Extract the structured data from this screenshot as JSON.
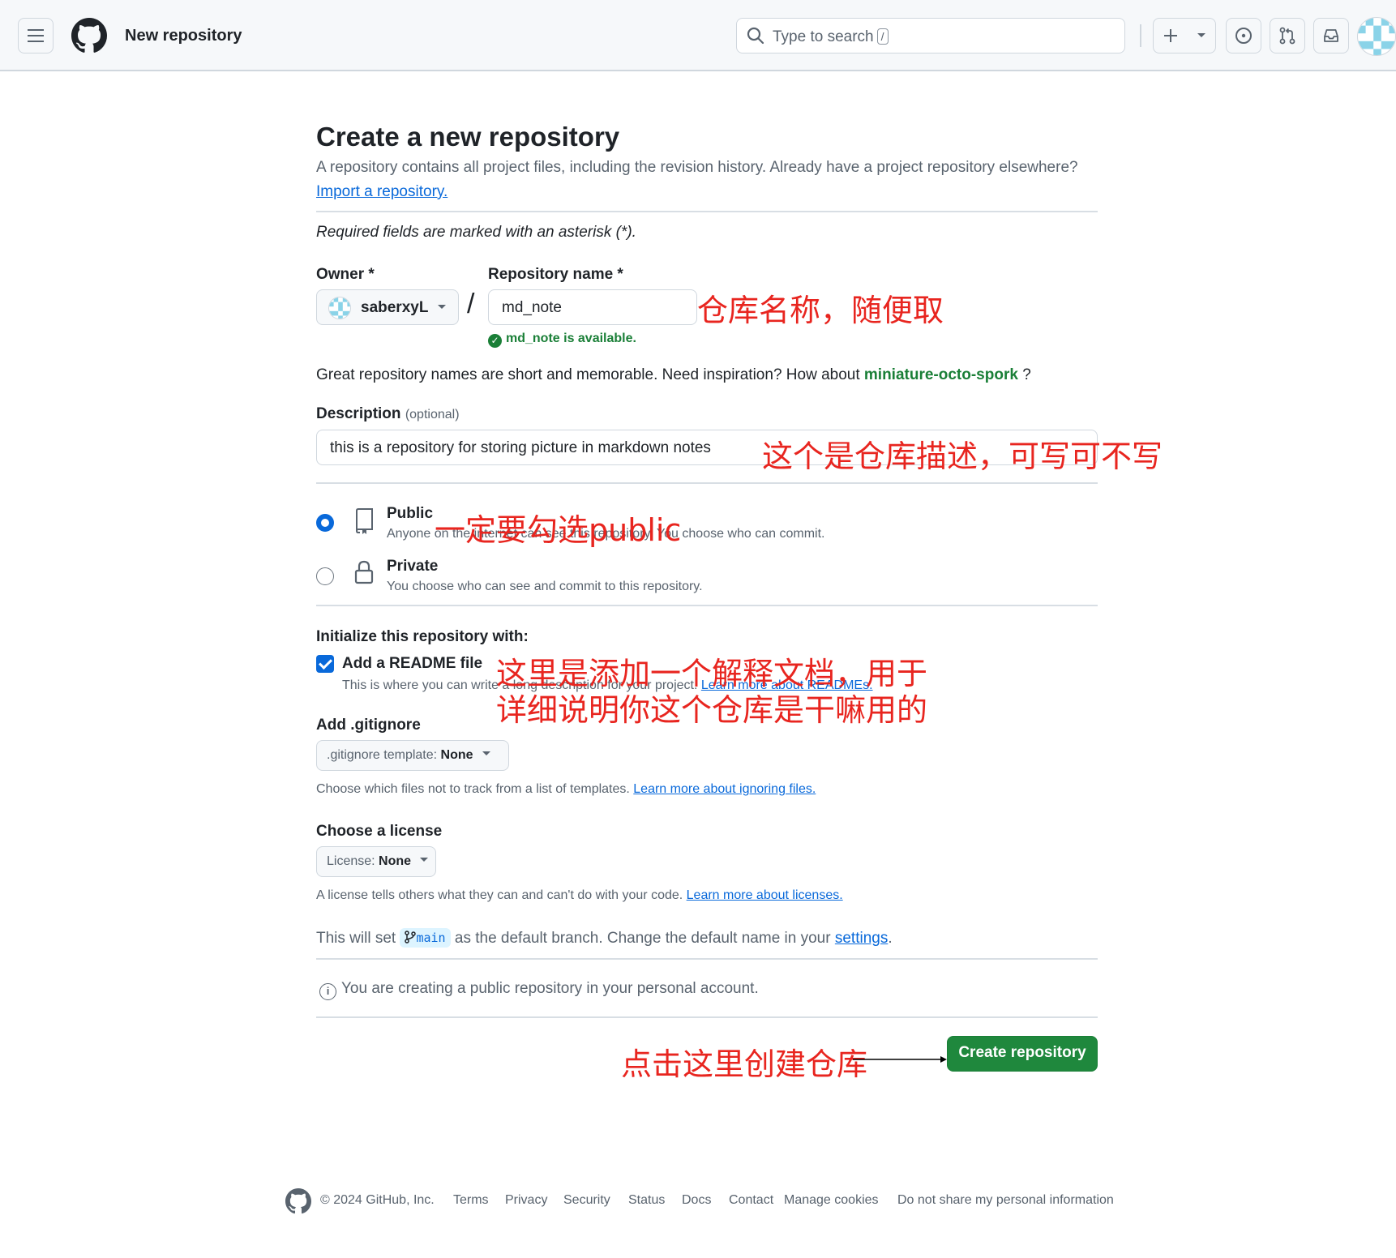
{
  "header": {
    "page_context": "New repository",
    "search_placeholder": "Type to search",
    "search_shortcut": "/"
  },
  "page": {
    "title": "Create a new repository",
    "lead": "A repository contains all project files, including the revision history. Already have a project repository elsewhere?",
    "import_link": "Import a repository.",
    "required_note": "Required fields are marked with an asterisk (*)."
  },
  "owner": {
    "label": "Owner *",
    "value": "saberxyL"
  },
  "repo_name": {
    "label": "Repository name *",
    "value": "md_note",
    "availability": "md_note is available."
  },
  "suggestion": {
    "text": "Great repository names are short and memorable. Need inspiration? How about",
    "name": "miniature-octo-spork",
    "suffix": " ?"
  },
  "description": {
    "label": "Description",
    "optional": "(optional)",
    "value": "this is a repository for storing picture in markdown notes"
  },
  "visibility": {
    "public_title": "Public",
    "public_desc": "Anyone on the internet can see this repository. You choose who can commit.",
    "private_title": "Private",
    "private_desc": "You choose who can see and commit to this repository.",
    "selected": "public"
  },
  "init": {
    "label": "Initialize this repository with:",
    "readme_title": "Add a README file",
    "readme_desc": "This is where you can write a long description for your project.",
    "readme_link": "Learn more about READMEs.",
    "readme_checked": true
  },
  "gitignore": {
    "label": "Add .gitignore",
    "dropdown_prefix": ".gitignore template:",
    "dropdown_value": "None",
    "help": "Choose which files not to track from a list of templates.",
    "help_link": "Learn more about ignoring files."
  },
  "license": {
    "label": "Choose a license",
    "dropdown_prefix": "License:",
    "dropdown_value": "None",
    "help": "A license tells others what they can and can't do with your code.",
    "help_link": "Learn more about licenses."
  },
  "branch": {
    "prefix": "This will set",
    "name": "main",
    "middle": "as the default branch. Change the default name in your",
    "settings_link": "settings",
    "suffix": "."
  },
  "notice": "You are creating a public repository in your personal account.",
  "create_button": "Create repository",
  "annotations": {
    "repo_name": "仓库名称，随便取",
    "description": "这个是仓库描述，可写可不写",
    "public": "一定要勾选public",
    "readme_line1": "这里是添加一个解释文档，用于",
    "readme_line2": "详细说明你这个仓库是干嘛用的",
    "create": "点击这里创建仓库"
  },
  "footer": {
    "copyright": "© 2024 GitHub, Inc.",
    "links": [
      "Terms",
      "Privacy",
      "Security",
      "Status",
      "Docs",
      "Contact",
      "Manage cookies",
      "Do not share my personal information"
    ]
  },
  "colors": {
    "accent": "#0969da",
    "success": "#1a7f37",
    "primary_button": "#1f883d",
    "annotation": "#e8251f"
  }
}
